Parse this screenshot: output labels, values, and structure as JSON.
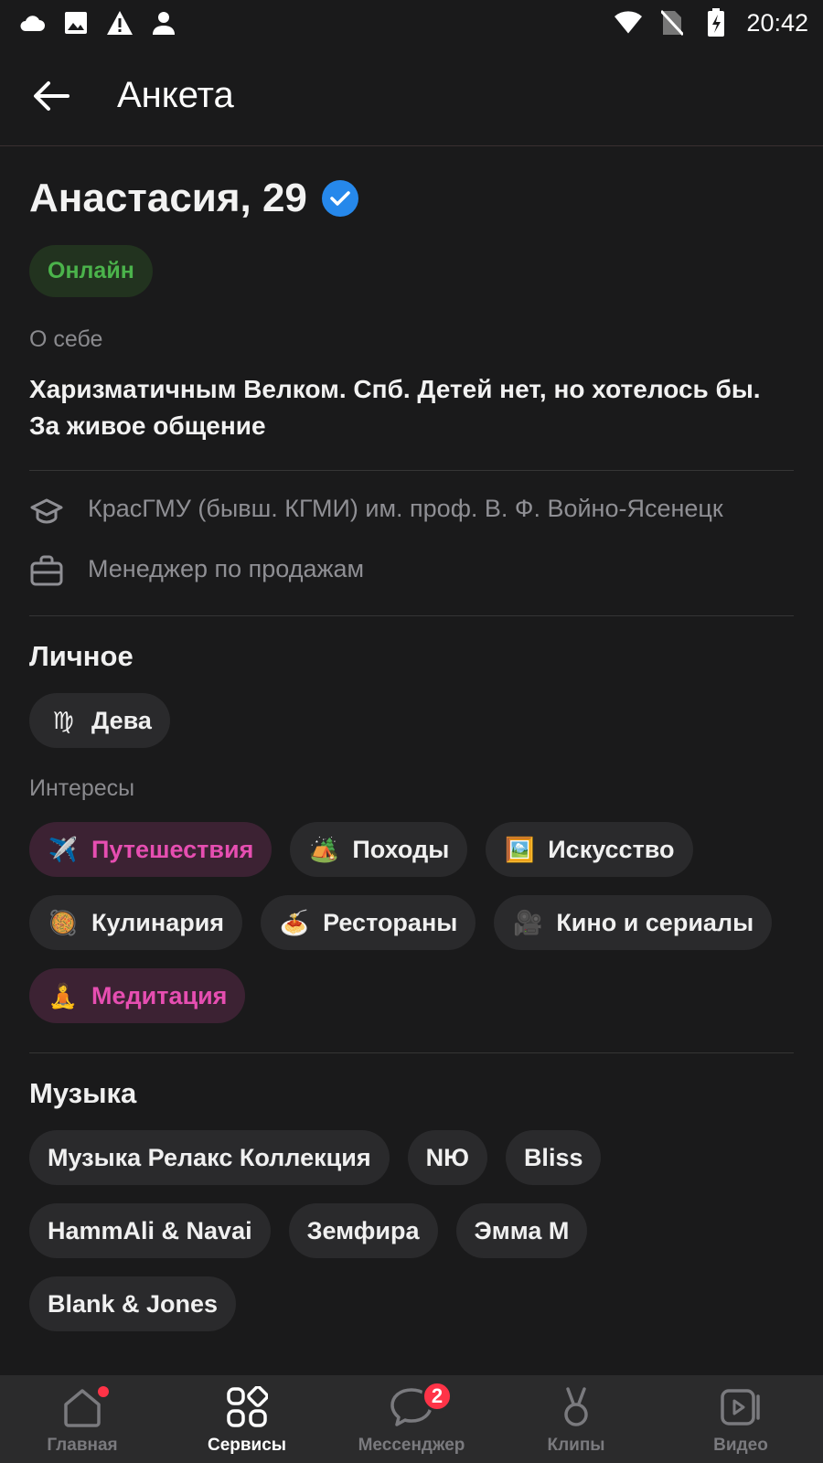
{
  "status_bar": {
    "time": "20:42",
    "left_icons": [
      "cloud-icon",
      "image-icon",
      "warning-icon",
      "person-icon"
    ],
    "right_icons": [
      "wifi-icon",
      "no-sim-icon",
      "battery-charging-icon"
    ]
  },
  "header": {
    "title": "Анкета"
  },
  "profile": {
    "name": "Анастасия, 29",
    "online_label": "Онлайн",
    "about_caption": "О себе",
    "about_text": "Харизматичным Велком. Спб. Детей нет, но хотелось бы. За живое общение",
    "education": "КрасГМУ (бывш. КГМИ) им. проф. В. Ф. Войно-Ясенецк",
    "job": "Менеджер по продажам"
  },
  "personal": {
    "title": "Личное",
    "zodiac": {
      "emoji": "♍",
      "label": "Дева"
    },
    "interests_caption": "Интересы",
    "interests": [
      {
        "emoji": "✈️",
        "label": "Путешествия",
        "highlight": true
      },
      {
        "emoji": "🏕️",
        "label": "Походы",
        "highlight": false
      },
      {
        "emoji": "🖼️",
        "label": "Искусство",
        "highlight": false
      },
      {
        "emoji": "🥘",
        "label": "Кулинария",
        "highlight": false
      },
      {
        "emoji": "🍝",
        "label": "Рестораны",
        "highlight": false
      },
      {
        "emoji": "🎥",
        "label": "Кино и сериалы",
        "highlight": false
      },
      {
        "emoji": "🧘",
        "label": "Медитация",
        "highlight": true
      }
    ]
  },
  "music": {
    "title": "Музыка",
    "artists": [
      "Музыка Релакс Коллекция",
      "NЮ",
      "Bliss",
      "HammAli & Navai",
      "Земфира",
      "Эмма М",
      "Blank & Jones"
    ]
  },
  "bottom_nav": {
    "items": [
      {
        "label": "Главная",
        "icon": "home-icon"
      },
      {
        "label": "Сервисы",
        "icon": "services-icon"
      },
      {
        "label": "Мессенджер",
        "icon": "messenger-icon",
        "badge": "2"
      },
      {
        "label": "Клипы",
        "icon": "clips-icon"
      },
      {
        "label": "Видео",
        "icon": "video-icon"
      }
    ]
  },
  "colors": {
    "background": "#1a1a1b",
    "accent_blue": "#2688eb",
    "online_green": "#4bb34b",
    "highlight_pink": "#e64eb1",
    "badge_red": "#ff3347"
  }
}
